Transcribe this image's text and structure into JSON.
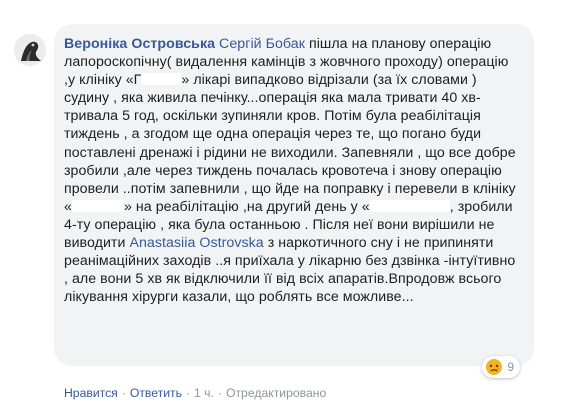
{
  "comment": {
    "author": "Вероніка Островська",
    "mention": "Сергій Бобак",
    "text_1": " пішла на планову операцію лапороскопічну( видалення камінців з жовчного проходу) операцію ,у клініку «Г",
    "text_2": "» лікарі випадково відрізали (за їх словами ) судину , яка живила печінку...операція яка мала тривати 40 хв-тривала 5 год, оскільки зупиняли кров. Потім була реабілітація тиждень , а згодом ще одна операція через те, що погано буди поставлені дренажі і рідини не виходили. Запевняли , що все добре зробили ,але через тиждень почалась кровотеча і знову операцію провели ..потім запевнили , що йде на поправку і перевели в клініку «",
    "text_3": "» на реабілітацію ,на другий день у «",
    "text_4": ", зробили 4-ту операцію , яка була останньою . Після неї вони вирішили не виводити ",
    "mention_2": "Anastasiia Ostrovska",
    "text_5": " з наркотичного сну і не припиняти реанімаційних заходів ..я приїхала у лікарню без дзвінка -інтуїтивно , але вони 5 хв як відключили її від всіх апаратів.Впродовж всього лікування хірурги казали, що роблять все можливе..."
  },
  "reactions": {
    "icon": "sad-emoji",
    "count": "9",
    "color": "#f7b125"
  },
  "actions": {
    "like": "Нравится",
    "reply": "Ответить",
    "time": "1 ч.",
    "edited": "Отредактировано"
  },
  "colors": {
    "link": "#385898",
    "text": "#1c1e21",
    "meta": "#90949c",
    "bubble": "#f2f3f5"
  }
}
